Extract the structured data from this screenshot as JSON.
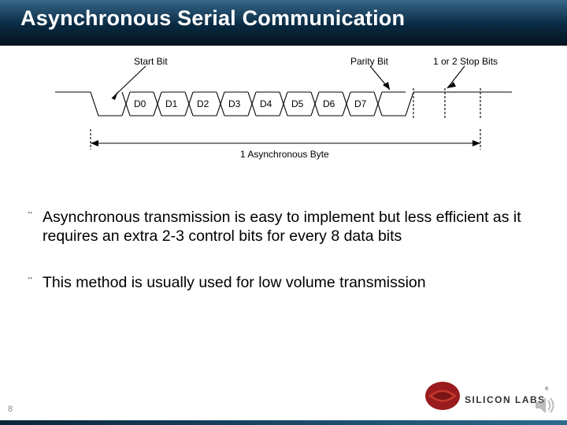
{
  "slide": {
    "title": "Asynchronous Serial Communication",
    "page_number": "8"
  },
  "diagram": {
    "labels": {
      "start_bit": "Start Bit",
      "parity_bit": "Parity Bit",
      "stop_bits": "1 or 2 Stop Bits",
      "byte_span": "1 Asynchronous Byte"
    },
    "bits": [
      "D0",
      "D1",
      "D2",
      "D3",
      "D4",
      "D5",
      "D6",
      "D7"
    ]
  },
  "bullets": [
    "Asynchronous transmission is easy to implement but less efficient as it requires an extra 2-3 control bits for every 8 data bits",
    "This method is usually used for low volume transmission"
  ],
  "branding": {
    "company": "SILICON LABS"
  }
}
